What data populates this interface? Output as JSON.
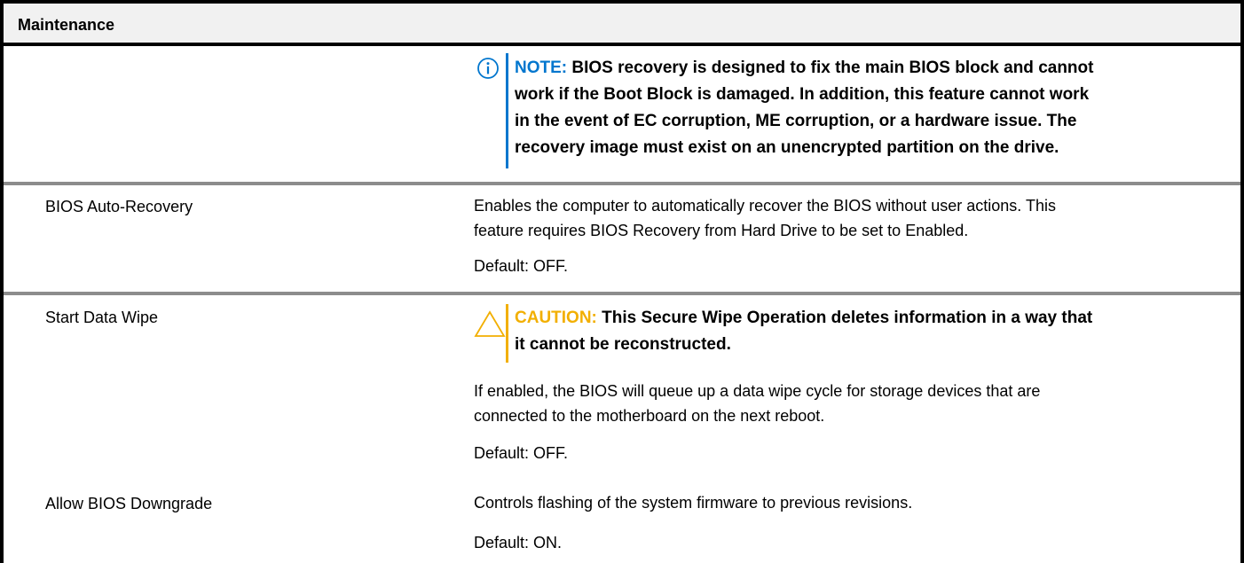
{
  "table": {
    "header": "Maintenance",
    "note": {
      "keyword": "NOTE:",
      "text": "BIOS recovery is designed to fix the main BIOS block and cannot",
      "lines": [
        "work if the Boot Block is damaged. In addition, this feature cannot work",
        "in the event of EC corruption, ME corruption, or a hardware issue. The",
        "recovery image must exist on an unencrypted partition on the drive."
      ]
    },
    "rows": [
      {
        "label": "BIOS Auto-Recovery",
        "description_lines": [
          "Enables the computer to automatically recover the BIOS without user actions. This",
          "feature requires BIOS Recovery from Hard Drive to be set to Enabled."
        ],
        "default": "Default: OFF."
      },
      {
        "label": "Start Data Wipe",
        "caution": {
          "keyword": "CAUTION:",
          "text": "This Secure Wipe Operation deletes information in a way that",
          "line2": "it cannot be reconstructed."
        },
        "description_lines": [
          "If enabled, the BIOS will queue up a data wipe cycle for storage devices that are",
          "connected to the motherboard on the next reboot."
        ],
        "default": "Default: OFF."
      },
      {
        "label": "Allow BIOS Downgrade",
        "description_lines": [
          "Controls flashing of the system firmware to previous revisions."
        ],
        "default": "Default: ON."
      }
    ],
    "colors": {
      "note_blue": "#0076ce",
      "caution_amber": "#f2af00",
      "header_bg": "#f1f1f1",
      "rule_grey": "#8c8c8c"
    },
    "icons": {
      "note": "info-icon",
      "caution": "warning-triangle-icon"
    }
  }
}
